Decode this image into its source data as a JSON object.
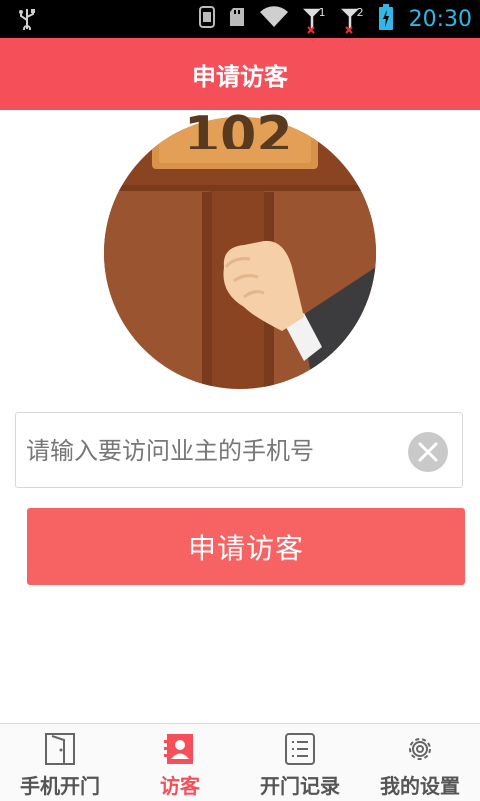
{
  "status_bar": {
    "time": "20:30",
    "signal_1_label": "1",
    "signal_2_label": "2",
    "icons": [
      "usb-icon",
      "sim-icon",
      "sdcard-icon",
      "wifi-icon",
      "signal-icon",
      "signal-icon",
      "battery-charging-icon"
    ]
  },
  "header": {
    "title": "申请访客"
  },
  "hero": {
    "door_number": "102"
  },
  "form": {
    "phone_placeholder": "请输入要访问业主的手机号",
    "phone_value": "",
    "submit_label": "申请访客"
  },
  "tabbar": {
    "active_tab": "访客",
    "tabs": [
      {
        "label": "手机开门",
        "icon": "door-icon"
      },
      {
        "label": "访客",
        "icon": "visitor-card-icon"
      },
      {
        "label": "开门记录",
        "icon": "list-icon"
      },
      {
        "label": "我的设置",
        "icon": "gear-icon"
      }
    ]
  },
  "colors": {
    "brand": "#f5505a",
    "button": "#f76263",
    "status_time": "#33b5e5"
  }
}
